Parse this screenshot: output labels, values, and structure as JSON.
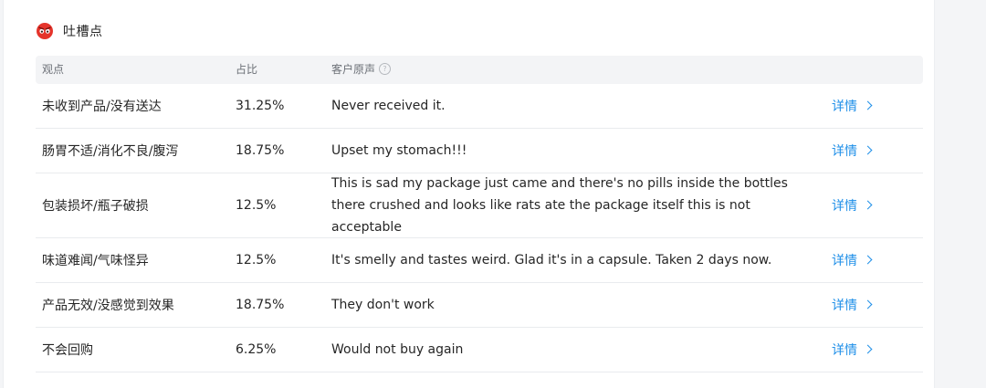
{
  "section": {
    "title": "吐槽点",
    "icon": "angry-face-icon",
    "accent_color": "#e5342b"
  },
  "table": {
    "columns": {
      "viewpoint": "观点",
      "ratio": "占比",
      "voice": "客户原声"
    },
    "help_glyph": "?",
    "detail_label": "详情",
    "rows": [
      {
        "viewpoint": "未收到产品/没有送达",
        "ratio": "31.25%",
        "voice": "Never received it."
      },
      {
        "viewpoint": "肠胃不适/消化不良/腹泻",
        "ratio": "18.75%",
        "voice": "Upset my stomach!!!"
      },
      {
        "viewpoint": "包装损坏/瓶子破损",
        "ratio": "12.5%",
        "voice": "This is sad my package just came and there's no pills inside the bottles there crushed and looks like rats ate the package itself this is not acceptable"
      },
      {
        "viewpoint": "味道难闻/气味怪异",
        "ratio": "12.5%",
        "voice": "It's smelly and tastes weird. Glad it's in a capsule. Taken 2 days now."
      },
      {
        "viewpoint": "产品无效/没感觉到效果",
        "ratio": "18.75%",
        "voice": "They don't work"
      },
      {
        "viewpoint": "不会回购",
        "ratio": "6.25%",
        "voice": "Would not buy again"
      }
    ]
  }
}
